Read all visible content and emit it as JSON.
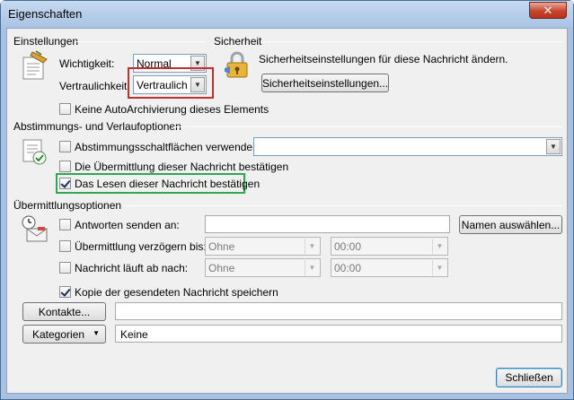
{
  "window": {
    "title": "Eigenschaften",
    "close_glyph": "✕"
  },
  "einstellungen": {
    "heading": "Einstellungen",
    "wichtigkeit_label": "Wichtigkeit:",
    "wichtigkeit_value": "Normal",
    "vertraulichkeit_label": "Vertraulichkeit:",
    "vertraulichkeit_value": "Vertraulich",
    "autoarchiv_label": "Keine AutoArchivierung dieses Elements",
    "autoarchiv_checked": false
  },
  "sicherheit": {
    "heading": "Sicherheit",
    "description": "Sicherheitseinstellungen für diese Nachricht ändern.",
    "button_label": "Sicherheitseinstellungen..."
  },
  "abstimmung": {
    "heading": "Abstimmungs- und Verlaufoptionen",
    "voting_label": "Abstimmungsschaltflächen verwenden:",
    "voting_checked": false,
    "voting_value": "",
    "delivery_label": "Die Übermittlung dieser Nachricht bestätigen",
    "delivery_checked": false,
    "read_label": "Das Lesen dieser Nachricht bestätigen",
    "read_checked": true
  },
  "uebermittlung": {
    "heading": "Übermittlungsoptionen",
    "reply_label": "Antworten senden an:",
    "reply_checked": false,
    "reply_value": "",
    "names_button": "Namen auswählen...",
    "delay_label": "Übermittlung verzögern bis:",
    "delay_checked": false,
    "delay_date": "Ohne",
    "delay_time": "00:00",
    "expire_label": "Nachricht läuft ab nach:",
    "expire_checked": false,
    "expire_date": "Ohne",
    "expire_time": "00:00",
    "copy_label": "Kopie der gesendeten Nachricht speichern",
    "copy_checked": true
  },
  "kontakte": {
    "button_label": "Kontakte...",
    "value": ""
  },
  "kategorien": {
    "button_label": "Kategorien",
    "value": "Keine"
  },
  "footer": {
    "close_button": "Schließen"
  },
  "colors": {
    "highlight_red": "#c0312b",
    "highlight_green": "#2fa84f"
  }
}
